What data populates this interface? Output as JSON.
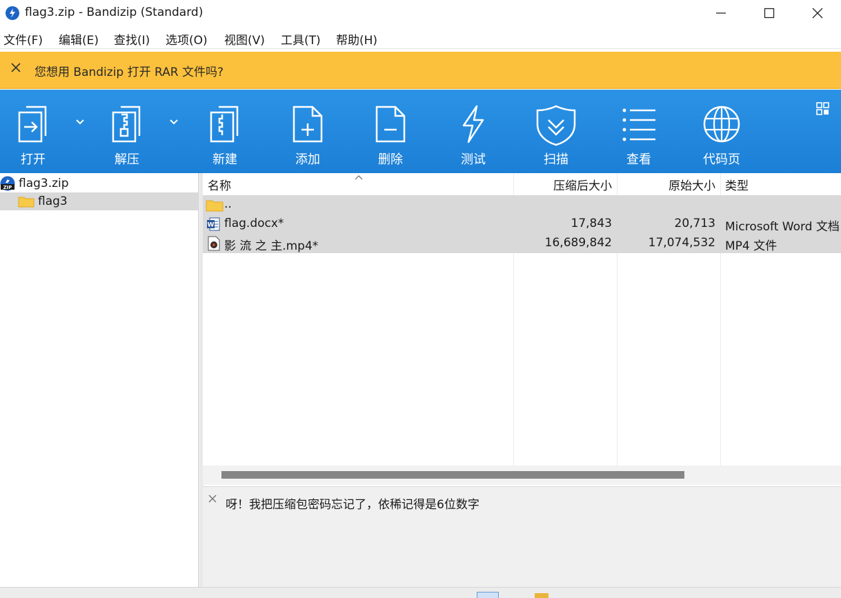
{
  "window": {
    "title": "flag3.zip - Bandizip (Standard)"
  },
  "menu": [
    "文件(F)",
    "编辑(E)",
    "查找(I)",
    "选项(O)",
    "视图(V)",
    "工具(T)",
    "帮助(H)"
  ],
  "notification": {
    "text": "您想用 Bandizip 打开 RAR 文件吗?"
  },
  "toolbar": [
    {
      "label": "打开",
      "icon": "open-archive-icon"
    },
    {
      "label": "解压",
      "icon": "extract-zipper-icon"
    },
    {
      "label": "新建",
      "icon": "new-archive-icon"
    },
    {
      "label": "添加",
      "icon": "add-file-icon"
    },
    {
      "label": "删除",
      "icon": "delete-file-icon"
    },
    {
      "label": "测试",
      "icon": "test-lightning-icon"
    },
    {
      "label": "扫描",
      "icon": "scan-shield-icon"
    },
    {
      "label": "查看",
      "icon": "view-list-icon"
    },
    {
      "label": "代码页",
      "icon": "codepage-globe-icon"
    }
  ],
  "tree": [
    {
      "label": "flag3.zip",
      "icon": "zip-archive-icon"
    },
    {
      "label": "flag3",
      "icon": "folder-icon"
    }
  ],
  "columns": {
    "name": "名称",
    "compressed": "压缩后大小",
    "original": "原始大小",
    "type": "类型"
  },
  "files": [
    {
      "name": "..",
      "icon": "folder-icon",
      "compressed": "",
      "original": "",
      "type": ""
    },
    {
      "name": "flag.docx*",
      "icon": "word-document-icon",
      "compressed": "17,843",
      "original": "20,713",
      "type": "Microsoft Word 文档"
    },
    {
      "name": "影 流 之 主.mp4*",
      "icon": "video-file-icon",
      "compressed": "16,689,842",
      "original": "17,074,532",
      "type": "MP4 文件"
    }
  ],
  "comment": {
    "text": "呀！我把压缩包密码忘记了，依稀记得是6位数字"
  },
  "colors": {
    "toolbar": "#1e87dc",
    "notice": "#fcc13c",
    "selection": "#d9d9d9"
  }
}
